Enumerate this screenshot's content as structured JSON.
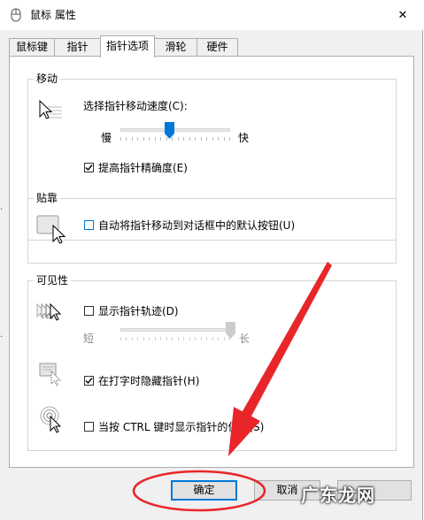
{
  "window": {
    "title": "鼠标 属性",
    "close_glyph": "✕"
  },
  "tabs": [
    {
      "label": "鼠标键",
      "active": false
    },
    {
      "label": "指针",
      "active": false
    },
    {
      "label": "指针选项",
      "active": true
    },
    {
      "label": "滑轮",
      "active": false
    },
    {
      "label": "硬件",
      "active": false
    }
  ],
  "motion": {
    "title": "移动",
    "speed_label": "选择指针移动速度(C):",
    "slow_label": "慢",
    "fast_label": "快",
    "speed_value": 0.45,
    "precision_label": "提高指针精确度(E)",
    "precision_checked": true
  },
  "snap": {
    "title": "贴靠",
    "snap_label": "自动将指针移动到对话框中的默认按钮(U)",
    "snap_checked": false
  },
  "visibility": {
    "title": "可见性",
    "trails_label": "显示指针轨迹(D)",
    "trails_checked": false,
    "short_label": "短",
    "long_label": "长",
    "trail_value": 1.0,
    "hide_label": "在打字时隐藏指针(H)",
    "hide_checked": true,
    "ctrl_label": "当按 CTRL 键时显示指针的位置(S)",
    "ctrl_checked": false
  },
  "buttons": {
    "ok_label": "确定",
    "cancel_label": "取消"
  },
  "watermark": {
    "text": "广东龙网"
  },
  "colors": {
    "accent": "#0078d7",
    "annotation": "#e8262a"
  }
}
